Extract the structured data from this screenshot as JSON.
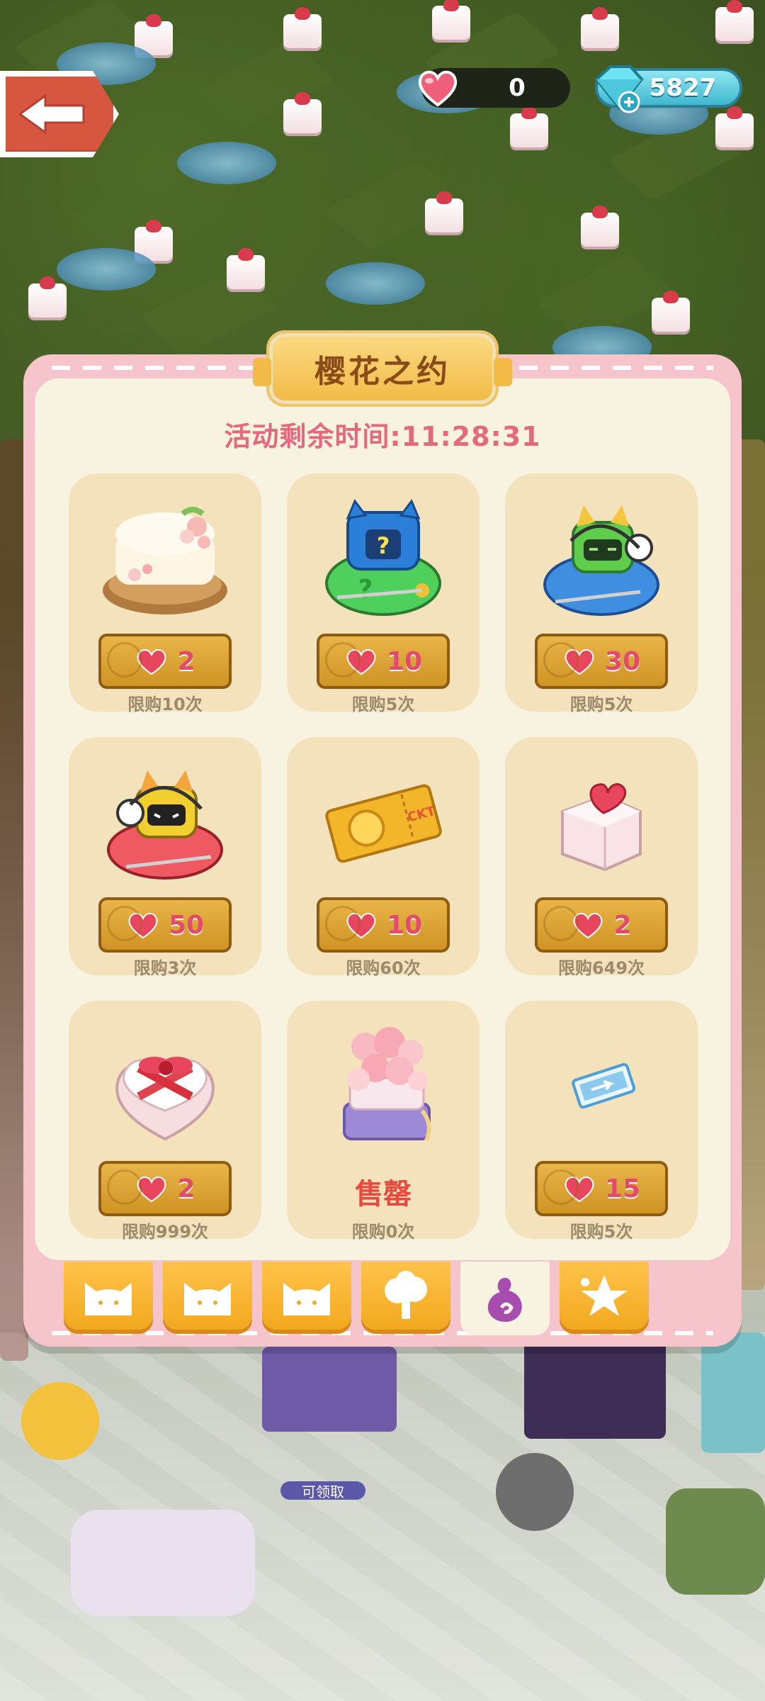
{
  "hud": {
    "hearts": "0",
    "gems": "5827"
  },
  "event": {
    "title": "樱花之约",
    "timer": "活动剩余时间:11:28:31"
  },
  "shop_items": [
    {
      "name": "sakura-cake",
      "price": "2",
      "limit": "限购10次"
    },
    {
      "name": "mystery-mech-green",
      "price": "10",
      "limit": "限购5次"
    },
    {
      "name": "mecha-blue",
      "price": "30",
      "limit": "限购5次"
    },
    {
      "name": "mecha-red",
      "price": "50",
      "limit": "限购3次"
    },
    {
      "name": "golden-ticket",
      "price": "10",
      "limit": "限购60次"
    },
    {
      "name": "heart-cake",
      "price": "2",
      "limit": "限购649次"
    },
    {
      "name": "heart-gift-box",
      "price": "2",
      "limit": "限购999次"
    },
    {
      "name": "flower-cake-tower",
      "soldout": "售罄",
      "limit": "限购0次"
    },
    {
      "name": "blue-ticket",
      "price": "15",
      "limit": "限购5次"
    }
  ],
  "tabs": [
    "cat-1",
    "cat-2",
    "cat-3",
    "tree",
    "gourd",
    "star"
  ],
  "active_tab": 4,
  "scene": {
    "claim_label": "可领取"
  },
  "colors": {
    "panel_border": "#f6c5cc",
    "panel_inner": "#f8f2e0",
    "card_bg": "#f4e2bc",
    "price_button": "#d9a232",
    "heart": "#e8455f",
    "timer_text": "#e3697f",
    "title_text": "#8a4b1a"
  }
}
